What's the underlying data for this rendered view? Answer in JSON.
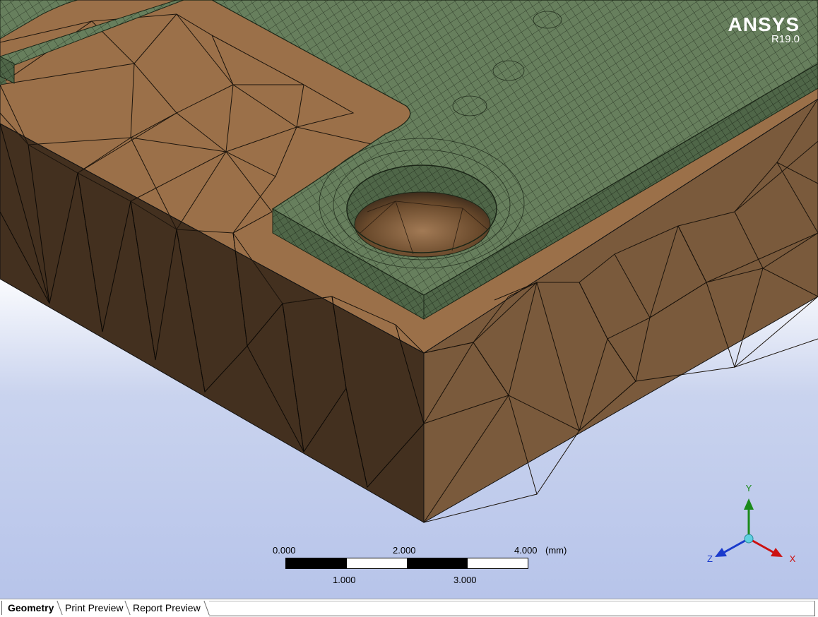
{
  "logo": {
    "name": "ANSYS",
    "revision": "R19.0"
  },
  "scale_bar": {
    "unit": "(mm)",
    "top_labels": [
      "0.000",
      "2.000",
      "4.000"
    ],
    "bottom_labels": [
      "1.000",
      "3.000"
    ]
  },
  "triad": {
    "x": "X",
    "y": "Y",
    "z": "Z",
    "x_color": "#cc1111",
    "y_color": "#1a8a1a",
    "z_color": "#1a3acc"
  },
  "tabs": [
    {
      "label": "Geometry",
      "active": true
    },
    {
      "label": "Print Preview",
      "active": false
    },
    {
      "label": "Report Preview",
      "active": false
    }
  ],
  "colors": {
    "mesh_green": "#667f5d",
    "body_brown": "#9a7048",
    "background_bottom": "#b7c4ea"
  }
}
